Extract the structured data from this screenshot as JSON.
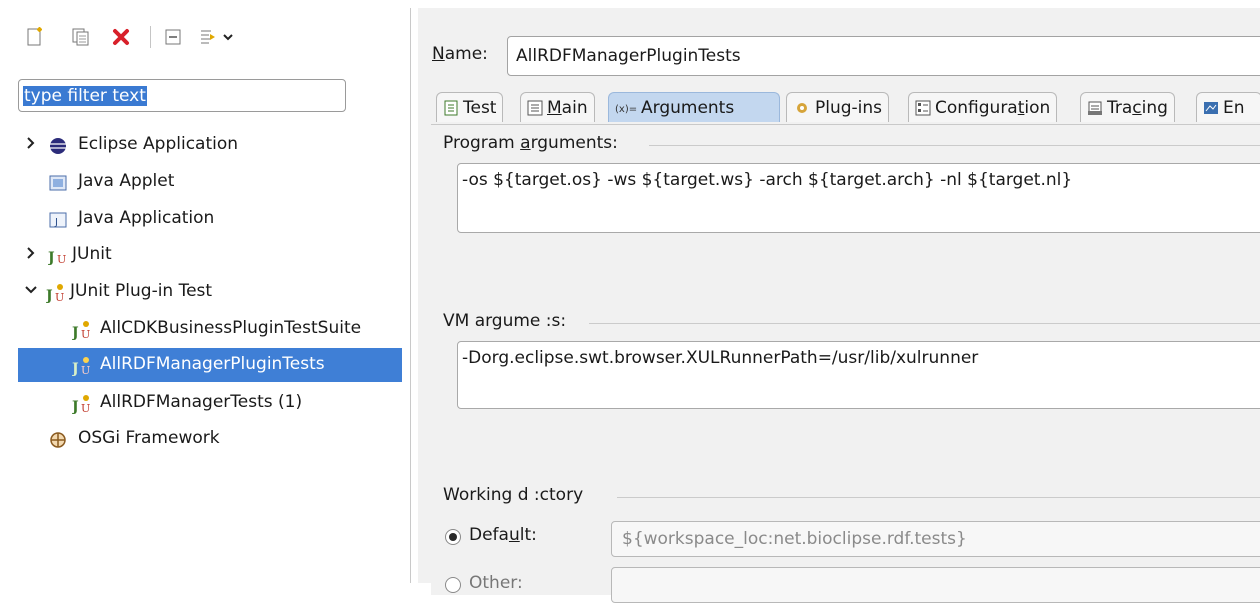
{
  "filter": {
    "placeholder": "type filter text"
  },
  "tree": {
    "eclipse_application": "Eclipse Application",
    "java_applet": "Java Applet",
    "java_application": "Java Application",
    "junit": "JUnit",
    "junit_plugin_test": "JUnit Plug-in Test",
    "all_cdk": "AllCDKBusinessPluginTestSuite",
    "all_rdf_plugin": "AllRDFManagerPluginTests",
    "all_rdf_tests": "AllRDFManagerTests (1)",
    "osgi": "OSGi Framework"
  },
  "config": {
    "name_label": "ame:",
    "name_prefix": "N",
    "name_value": "AllRDFManagerPluginTests"
  },
  "tabs": {
    "test": "Test",
    "main_m": "M",
    "main_rest": "ain",
    "arguments": "Arguments",
    "plugins": "Plug-ins",
    "configuration_pre": "Configura",
    "configuration_u": "t",
    "configuration_post": "ion",
    "tracing_pre": "Tra",
    "tracing_u": "c",
    "tracing_post": "ing",
    "env": "En"
  },
  "arguments": {
    "program_pre": "Program ",
    "program_u": "a",
    "program_post": "rguments:",
    "program_value": "-os ${target.os} -ws ${target.ws} -arch ${target.arch} -nl ${target.nl}",
    "vm_label": "VM argume  :s:",
    "vm_value": "-Dorg.eclipse.swt.browser.XULRunnerPath=/usr/lib/xulrunner",
    "working_dir_label": "Working d  :ctory",
    "default_pre": "Defa",
    "default_u": "u",
    "default_post": "lt:",
    "default_value": "${workspace_loc:net.bioclipse.rdf.tests}",
    "other_label": "Other:"
  },
  "colors": {
    "selection": "#3f7fd6",
    "active_tab": "#c3d7ef"
  }
}
